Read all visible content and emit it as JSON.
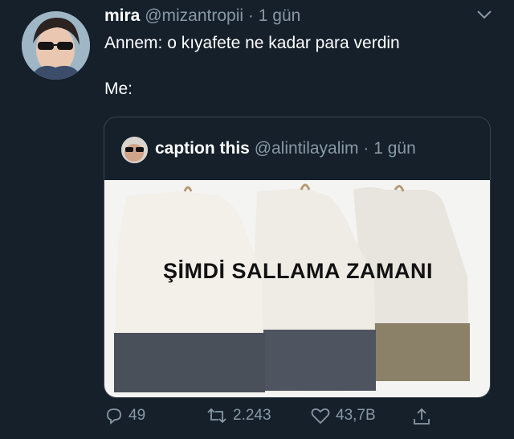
{
  "tweet": {
    "author_name": "mira",
    "handle": "@mizantropii",
    "separator": "·",
    "time": "1 gün",
    "text_line1": "Annem: o kıyafete ne kadar para verdin",
    "text_line2": "Me:"
  },
  "quote": {
    "author_name": "caption this",
    "handle": "@alintilayalim",
    "separator": "·",
    "time": "1 gün",
    "image_caption": "ŞİMDİ SALLAMA ZAMANI"
  },
  "actions": {
    "reply_count": "49",
    "retweet_count": "2.243",
    "like_count": "43,7B"
  },
  "colors": {
    "background": "#15202b",
    "secondary_text": "#8899a6",
    "border": "#38444d"
  },
  "icons": [
    "chevron-down-icon",
    "reply-icon",
    "retweet-icon",
    "like-icon",
    "share-icon"
  ]
}
